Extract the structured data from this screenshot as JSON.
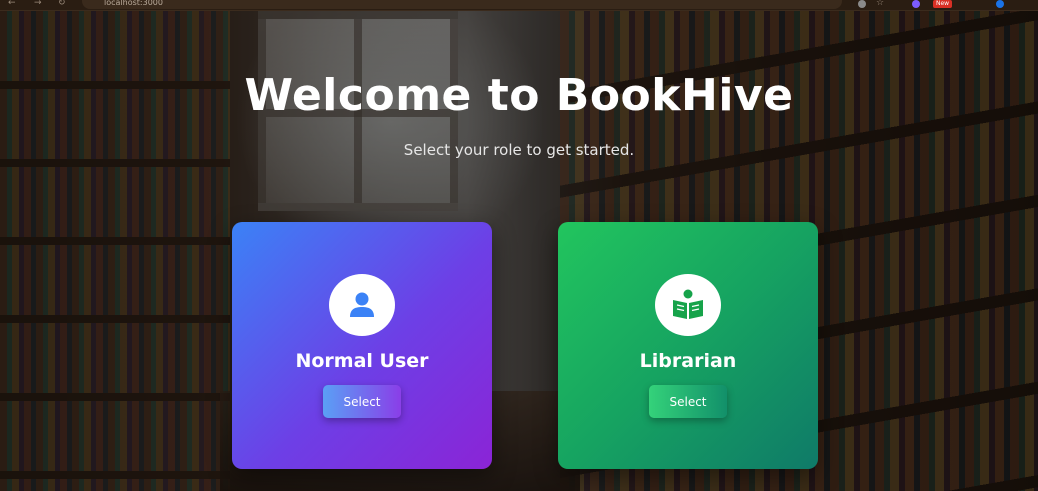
{
  "browser": {
    "url": "localhost:3000",
    "new_badge": "New"
  },
  "hero": {
    "title": "Welcome to BookHive",
    "subtitle": "Select your role to get started."
  },
  "roles": [
    {
      "name": "Normal User",
      "button_label": "Select",
      "icon": "user-icon"
    },
    {
      "name": "Librarian",
      "button_label": "Select",
      "icon": "book-reader-icon"
    }
  ],
  "colors": {
    "user_card_gradient": [
      "#3b82f6",
      "#8b24d6"
    ],
    "librarian_card_gradient": [
      "#22c55e",
      "#0f7a68"
    ],
    "user_icon_color": "#3b82f6",
    "librarian_icon_color": "#16a34a"
  }
}
